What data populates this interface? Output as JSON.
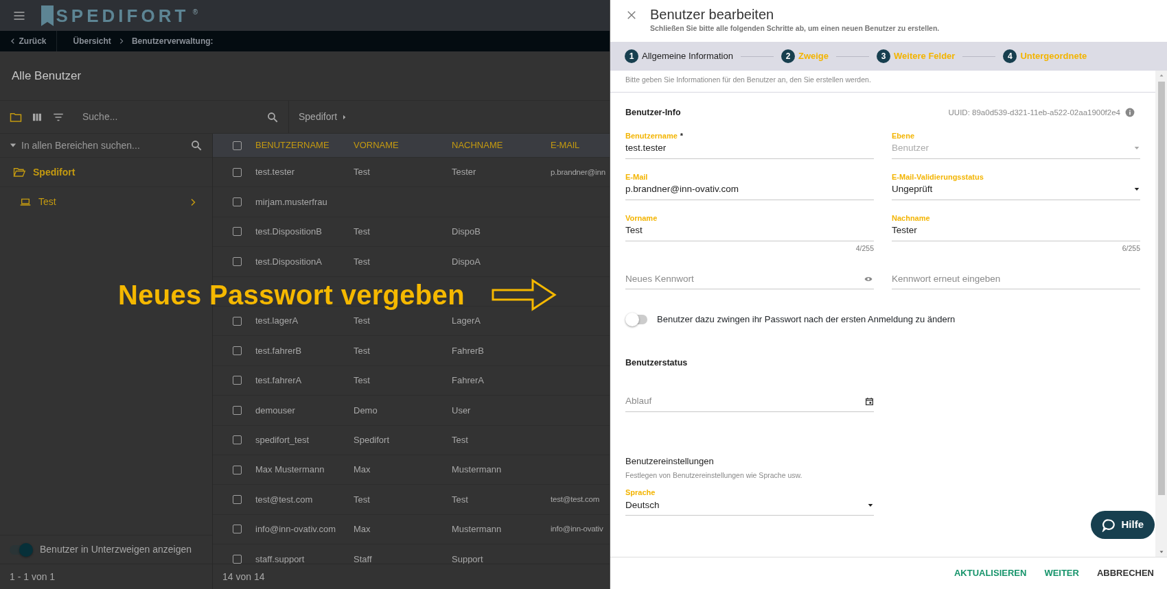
{
  "app_bar": {
    "logo": "SPEDIFORT",
    "trademark": "®"
  },
  "breadcrumb": {
    "back": "Zurück",
    "items": [
      "Übersicht",
      "Benutzerverwaltung:"
    ]
  },
  "page_title": "Alle Benutzer",
  "toolbar": {
    "search_placeholder": "Suche...",
    "path": "Spedifort"
  },
  "sidebar": {
    "search_placeholder": "In allen Bereichen suchen...",
    "tree": [
      {
        "label": "Spedifort",
        "expanded": true,
        "children": [
          {
            "label": "Test",
            "expanded": false
          }
        ]
      }
    ],
    "subbranch_toggle": {
      "label": "Benutzer in Unterzweigen anzeigen",
      "on": true
    },
    "pagination": "1 - 1 von 1"
  },
  "table": {
    "select_all_checked": false,
    "columns": [
      "BENUTZERNAME",
      "VORNAME",
      "NACHNAME",
      "E-MAIL"
    ],
    "rows": [
      {
        "checked": false,
        "cells": [
          "test.tester",
          "Test",
          "Tester",
          "p.brandner@inn"
        ]
      },
      {
        "checked": false,
        "cells": [
          "mirjam.musterfrau"
        ]
      },
      {
        "checked": false,
        "cells": [
          "test.DispositionB",
          "Test",
          "DispoB"
        ]
      },
      {
        "checked": false,
        "cells": [
          "test.DispositionA",
          "Test",
          "DispoA"
        ]
      },
      {},
      {
        "checked": false,
        "cells": [
          "test.lagerA",
          "Test",
          "LagerA"
        ]
      },
      {
        "checked": false,
        "cells": [
          "test.fahrerB",
          "Test",
          "FahrerB"
        ]
      },
      {
        "checked": false,
        "cells": [
          "test.fahrerA",
          "Test",
          "FahrerA"
        ]
      },
      {
        "checked": false,
        "cells": [
          "demouser",
          "Demo",
          "User"
        ]
      },
      {
        "checked": false,
        "cells": [
          "spedifort_test",
          "Spedifort",
          "Test"
        ]
      },
      {
        "checked": false,
        "cells": [
          "Max Mustermann",
          "Max",
          "Mustermann"
        ]
      },
      {
        "checked": false,
        "cells": [
          "test@test.com",
          "Test",
          "Test",
          "test@test.com"
        ]
      },
      {
        "checked": false,
        "cells": [
          "info@inn-ovativ.com",
          "Max",
          "Mustermann",
          "info@inn-ovativ"
        ]
      },
      {
        "checked": false,
        "cells": [
          "staff.support",
          "Staff",
          "Support"
        ]
      }
    ],
    "count": "14 von 14"
  },
  "annotation": {
    "text": "Neues Passwort vergeben"
  },
  "drawer": {
    "title": "Benutzer bearbeiten",
    "subtitle": "Schließen Sie bitte alle folgenden Schritte ab, um einen neuen Benutzer zu erstellen.",
    "steps": [
      {
        "number": "1",
        "label": "Allgemeine Information",
        "selected": true
      },
      {
        "number": "2",
        "label": "Zweige",
        "selected": false
      },
      {
        "number": "3",
        "label": "Weitere Felder",
        "selected": false
      },
      {
        "number": "4",
        "label": "Untergeordnete",
        "selected": false
      }
    ],
    "intro": "Bitte geben Sie Informationen für den Benutzer an, den Sie erstellen werden.",
    "user_info": {
      "heading": "Benutzer-Info",
      "uuid": "UUID: 89a0d539-d321-11eb-a522-02aa1900f2e4",
      "fields": [
        {
          "kind": "text",
          "label": "Benutzername",
          "required_mark": "*",
          "value": "test.tester"
        },
        {
          "kind": "select",
          "label": "Ebene",
          "value": "Benutzer",
          "disabled": true
        },
        {
          "kind": "text",
          "label": "E-Mail",
          "value": "p.brandner@inn-ovativ.com"
        },
        {
          "kind": "select",
          "label": "E-Mail-Validierungsstatus",
          "value": "Ungeprüft",
          "disabled": false
        },
        {
          "kind": "text",
          "label": "Vorname",
          "value": "Test",
          "counter": "4/255"
        },
        {
          "kind": "text",
          "label": "Nachname",
          "value": "Tester",
          "counter": "6/255"
        },
        {
          "kind": "password",
          "placeholder": "Neues Kennwort",
          "visibility_toggle": true
        },
        {
          "kind": "password",
          "placeholder": "Kennwort erneut eingeben",
          "visibility_toggle": false
        }
      ]
    },
    "force_change": {
      "label": "Benutzer dazu zwingen ihr Passwort nach der ersten Anmeldung zu ändern",
      "on": false
    },
    "status": {
      "heading": "Benutzerstatus",
      "expiry_placeholder": "Ablauf"
    },
    "settings": {
      "heading": "Benutzereinstellungen",
      "description": "Festlegen von Benutzereinstellungen wie Sprache usw.",
      "language": {
        "label": "Sprache",
        "value": "Deutsch"
      }
    },
    "help_button": "Hilfe",
    "actions": [
      {
        "label": "AKTUALISIEREN",
        "kind": "primary"
      },
      {
        "label": "WEITER",
        "kind": "primary"
      },
      {
        "label": "ABBRECHEN",
        "kind": "secondary"
      }
    ]
  }
}
